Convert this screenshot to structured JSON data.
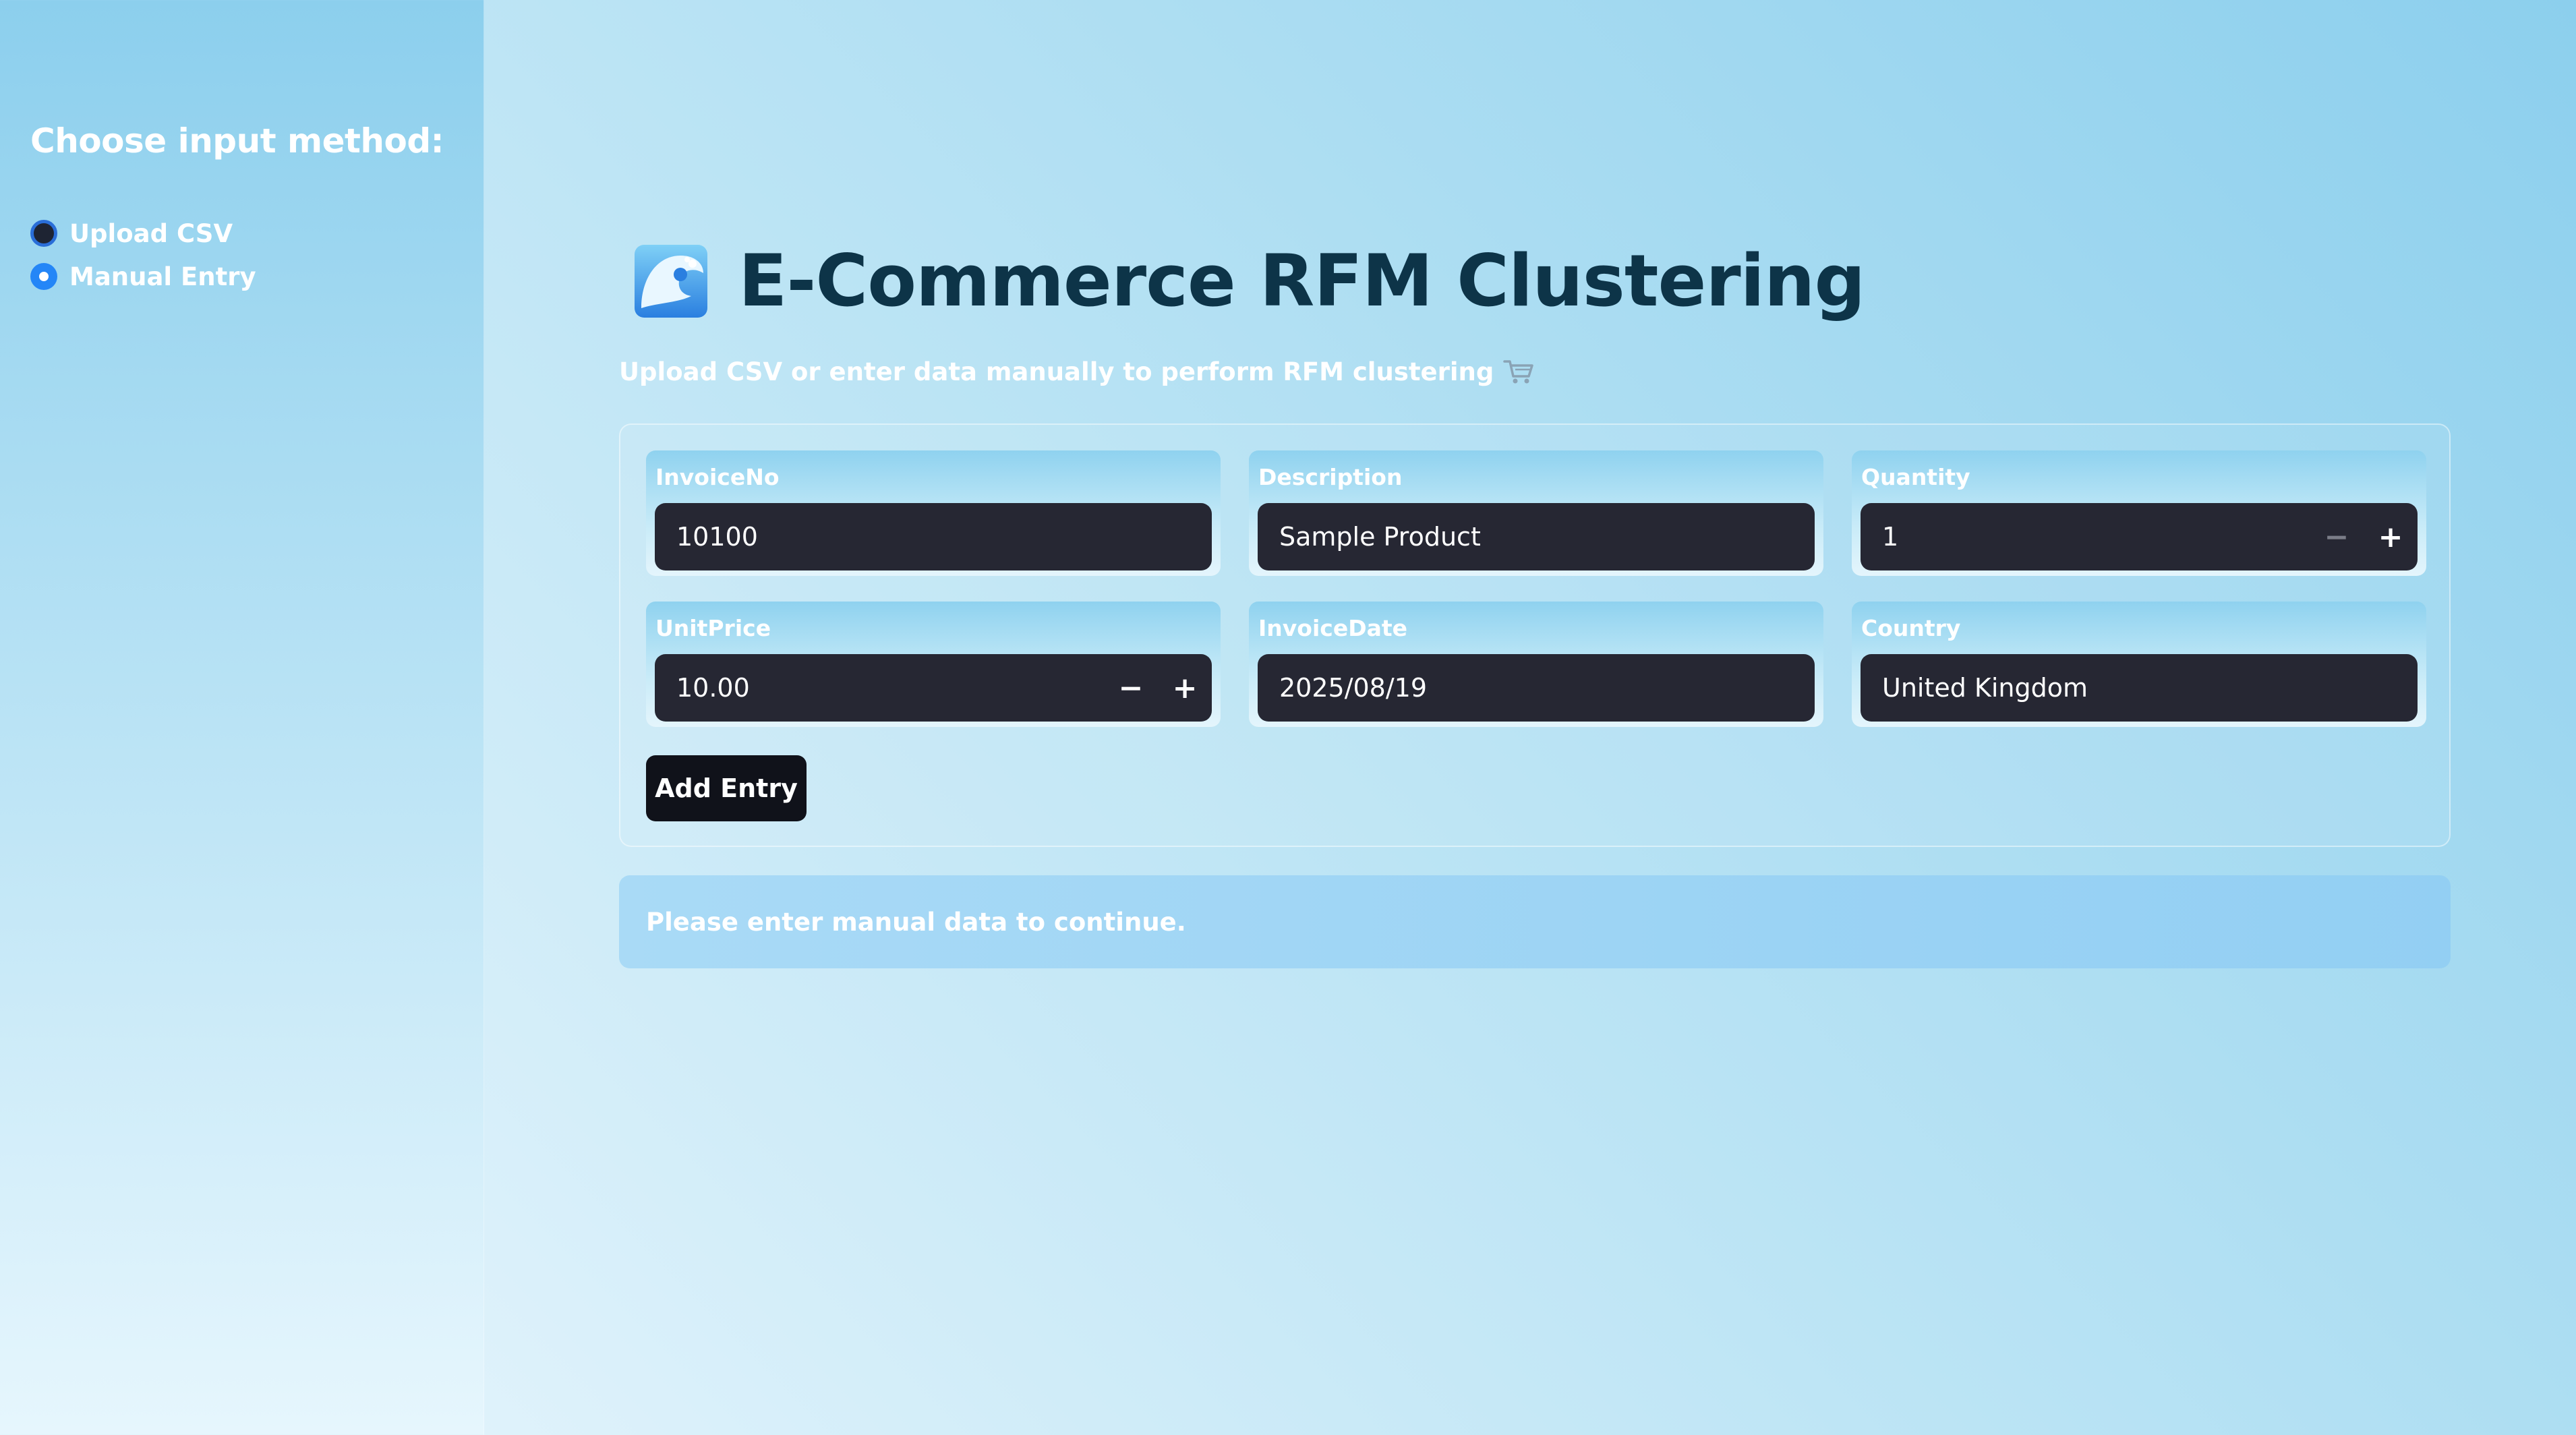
{
  "sidebar": {
    "heading": "Choose input method:",
    "options": [
      {
        "label": "Upload CSV",
        "selected": false
      },
      {
        "label": "Manual Entry",
        "selected": true
      }
    ]
  },
  "header": {
    "title": "E-Commerce RFM Clustering",
    "subtitle": "Upload CSV or enter data manually to perform RFM clustering",
    "title_icon": "wave-icon",
    "subtitle_icon": "shopping-cart-icon"
  },
  "form": {
    "fields": [
      {
        "label": "InvoiceNo",
        "value": "10100"
      },
      {
        "label": "Description",
        "value": "Sample Product"
      },
      {
        "label": "Quantity",
        "value": "1",
        "stepper": {
          "minus": "−",
          "plus": "+"
        }
      },
      {
        "label": "UnitPrice",
        "value": "10.00",
        "stepper": {
          "minus": "−",
          "plus": "+"
        }
      },
      {
        "label": "InvoiceDate",
        "value": "2025/08/19"
      },
      {
        "label": "Country",
        "value": "United Kingdom"
      }
    ],
    "add_button_label": "Add Entry"
  },
  "info": {
    "message": "Please enter manual data to continue."
  },
  "colors": {
    "title": "#0d3448",
    "input_bg": "#262733",
    "button_bg": "#10121a",
    "radio_accent": "#2486f7"
  }
}
